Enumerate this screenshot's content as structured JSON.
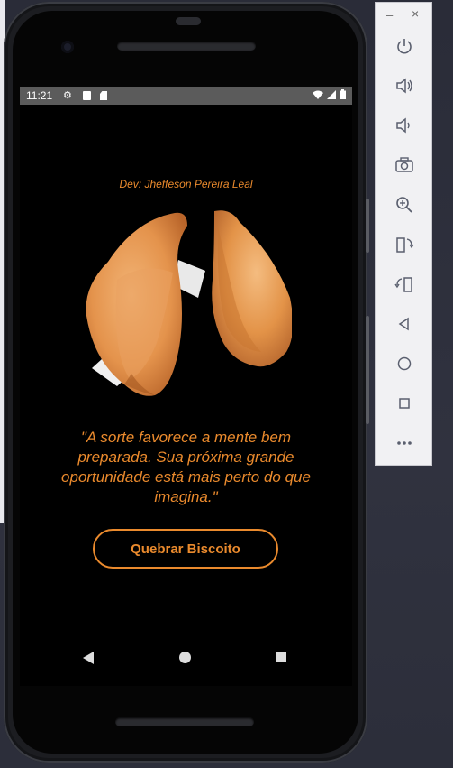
{
  "status_bar": {
    "time": "11:21"
  },
  "app": {
    "developer_credit": "Dev: Jheffeson Pereira Leal",
    "quote": "\"A sorte favorece a mente bem preparada. Sua próxima grande oportunidade está mais perto do que imagina.\"",
    "button_label": "Quebrar Biscoito",
    "accent_color": "#ea8a2d",
    "image": "fortune-cookie-broken"
  },
  "emulator_toolbar": {
    "window_controls": {
      "minimize": "–",
      "close": "×"
    },
    "tools": [
      "power-icon",
      "volume-up-icon",
      "volume-down-icon",
      "camera-icon",
      "zoom-icon",
      "rotate-left-icon",
      "rotate-right-icon",
      "back-icon",
      "home-icon",
      "overview-icon",
      "more-icon"
    ]
  }
}
